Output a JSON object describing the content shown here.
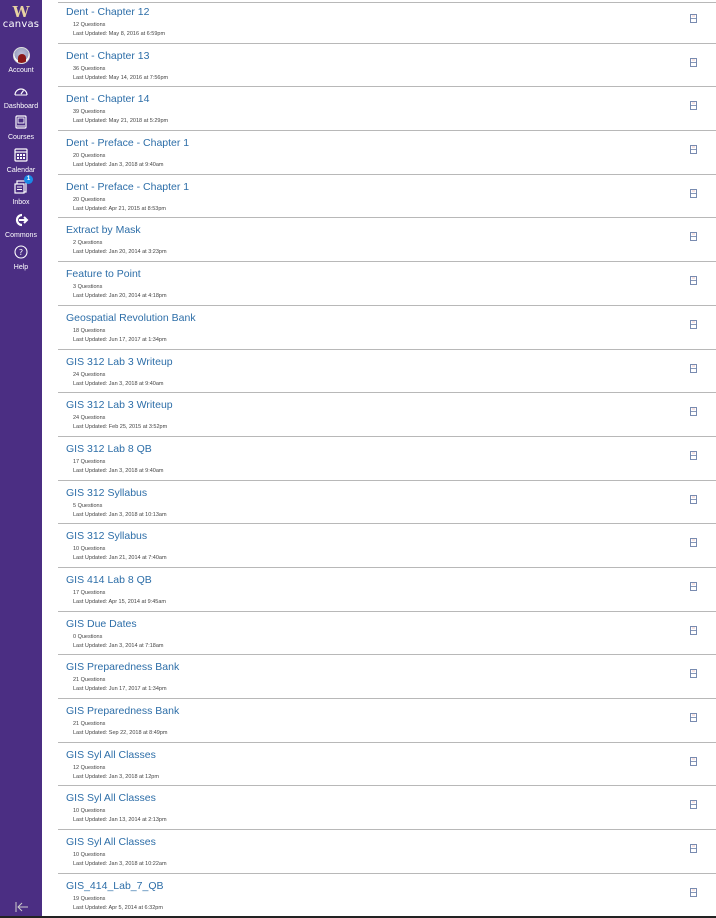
{
  "sidebar": {
    "logo_mark": "W",
    "logo_text": "canvas",
    "brand_color": "#4b2e83",
    "items": [
      {
        "label": "Account",
        "icon": "avatar-icon"
      },
      {
        "label": "Dashboard",
        "icon": "dashboard-icon"
      },
      {
        "label": "Courses",
        "icon": "courses-icon"
      },
      {
        "label": "Calendar",
        "icon": "calendar-icon"
      },
      {
        "label": "Inbox",
        "icon": "inbox-icon",
        "badge": "1"
      },
      {
        "label": "Commons",
        "icon": "commons-icon"
      },
      {
        "label": "Help",
        "icon": "help-icon"
      }
    ],
    "collapse_icon": "collapse-left-icon"
  },
  "banks": [
    {
      "title": "Dent - Chapter 12",
      "count": "12 Questions",
      "updated": "Last Updated: May 8, 2016 at 6:59pm"
    },
    {
      "title": "Dent - Chapter 13",
      "count": "36 Questions",
      "updated": "Last Updated: May 14, 2016 at 7:56pm"
    },
    {
      "title": "Dent - Chapter 14",
      "count": "39 Questions",
      "updated": "Last Updated: May 21, 2018 at 5:29pm"
    },
    {
      "title": "Dent - Preface - Chapter 1",
      "count": "20 Questions",
      "updated": "Last Updated: Jan 3, 2018 at 9:40am"
    },
    {
      "title": "Dent - Preface - Chapter 1",
      "count": "20 Questions",
      "updated": "Last Updated: Apr 21, 2015 at 8:53pm"
    },
    {
      "title": "Extract by Mask",
      "count": "2 Questions",
      "updated": "Last Updated: Jan 20, 2014 at 3:23pm"
    },
    {
      "title": "Feature to Point",
      "count": "3 Questions",
      "updated": "Last Updated: Jan 20, 2014 at 4:18pm"
    },
    {
      "title": "Geospatial Revolution Bank",
      "count": "18 Questions",
      "updated": "Last Updated: Jun 17, 2017 at 1:34pm"
    },
    {
      "title": "GIS 312 Lab 3 Writeup",
      "count": "24 Questions",
      "updated": "Last Updated: Jan 3, 2018 at 9:40am"
    },
    {
      "title": "GIS 312 Lab 3 Writeup",
      "count": "24 Questions",
      "updated": "Last Updated: Feb 25, 2015 at 3:52pm"
    },
    {
      "title": "GIS 312 Lab 8 QB",
      "count": "17 Questions",
      "updated": "Last Updated: Jan 3, 2018 at 9:40am"
    },
    {
      "title": "GIS 312 Syllabus",
      "count": "5 Questions",
      "updated": "Last Updated: Jan 3, 2018 at 10:13am"
    },
    {
      "title": "GIS 312 Syllabus",
      "count": "10 Questions",
      "updated": "Last Updated: Jan 21, 2014 at 7:40am"
    },
    {
      "title": "GIS 414 Lab 8 QB",
      "count": "17 Questions",
      "updated": "Last Updated: Apr 15, 2014 at 9:45am"
    },
    {
      "title": "GIS Due Dates",
      "count": "0 Questions",
      "updated": "Last Updated: Jan 3, 2014 at 7:18am"
    },
    {
      "title": "GIS Preparedness Bank",
      "count": "21 Questions",
      "updated": "Last Updated: Jun 17, 2017 at 1:34pm"
    },
    {
      "title": "GIS Preparedness Bank",
      "count": "21 Questions",
      "updated": "Last Updated: Sep 22, 2018 at 8:49pm"
    },
    {
      "title": "GIS Syl All Classes",
      "count": "12 Questions",
      "updated": "Last Updated: Jan 3, 2018 at 12pm"
    },
    {
      "title": "GIS Syl All Classes",
      "count": "10 Questions",
      "updated": "Last Updated: Jan 13, 2014 at 2:13pm"
    },
    {
      "title": "GIS Syl All Classes",
      "count": "10 Questions",
      "updated": "Last Updated: Jan 3, 2018 at 10:22am"
    },
    {
      "title": "GIS_414_Lab_7_QB",
      "count": "19 Questions",
      "updated": "Last Updated: Apr 5, 2014 at 6:32pm"
    }
  ],
  "bookmark_icon": "bookmark-icon",
  "link_color": "#2d6ea8"
}
